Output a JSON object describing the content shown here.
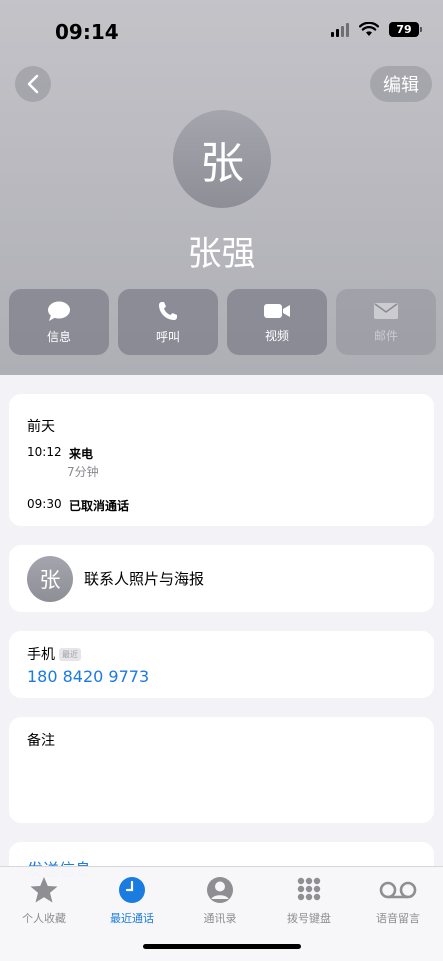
{
  "status": {
    "time": "09:14",
    "battery": "79"
  },
  "nav": {
    "edit_label": "编辑"
  },
  "contact": {
    "initial": "张",
    "name": "张强"
  },
  "actions": [
    {
      "label": "信息",
      "icon": "message-bubble-icon",
      "enabled": true
    },
    {
      "label": "呼叫",
      "icon": "phone-icon",
      "enabled": true
    },
    {
      "label": "视频",
      "icon": "video-camera-icon",
      "enabled": true
    },
    {
      "label": "邮件",
      "icon": "envelope-icon",
      "enabled": false
    }
  ],
  "recent_calls": {
    "date_label": "前天",
    "calls": [
      {
        "time": "10:12",
        "type": "来电",
        "duration": "7分钟"
      },
      {
        "time": "09:30",
        "type": "已取消通话"
      }
    ]
  },
  "poster": {
    "initial": "张",
    "label": "联系人照片与海报"
  },
  "phone": {
    "label": "手机",
    "tag": "最近",
    "number": "180 8420 9773"
  },
  "notes": {
    "label": "备注"
  },
  "send_message": {
    "label": "发送信息"
  },
  "tabbar": [
    {
      "label": "个人收藏",
      "icon": "star-icon",
      "active": false
    },
    {
      "label": "最近通话",
      "icon": "clock-icon",
      "active": true
    },
    {
      "label": "通讯录",
      "icon": "person-circle-icon",
      "active": false
    },
    {
      "label": "拨号键盘",
      "icon": "keypad-icon",
      "active": false
    },
    {
      "label": "语音留言",
      "icon": "voicemail-icon",
      "active": false
    }
  ],
  "colors": {
    "accent": "#1a7be0",
    "header_top": "#c3c3c8",
    "header_bottom": "#aeaeb5"
  }
}
